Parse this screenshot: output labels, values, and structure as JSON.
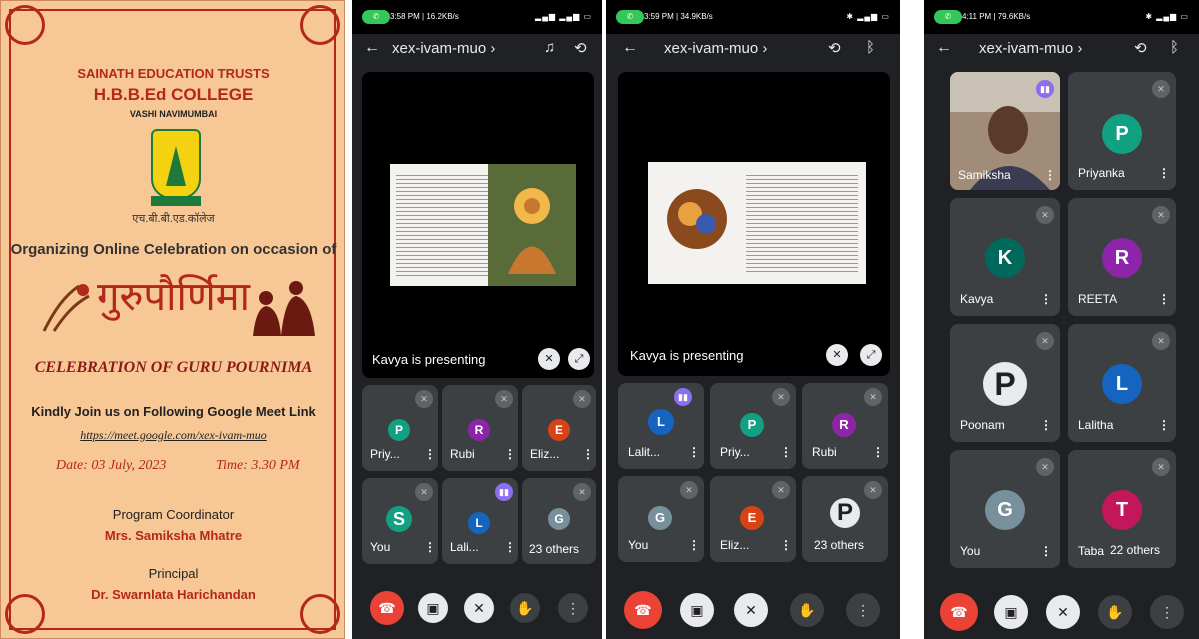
{
  "poster": {
    "trust": "SAINATH EDUCATION TRUSTS",
    "college": "H.B.B.Ed COLLEGE",
    "location": "VASHI NAVIMUMBAI",
    "hindi_name": "एच.बी.बी.एड.कॉलेज",
    "organizing": "Organizing Online Celebration on occasion of",
    "hindi_title": "गुरुपौर्णिमा",
    "celebration": "CELEBRATION OF GURU POURNIMA",
    "invite": "Kindly Join us on Following Google Meet Link",
    "link": "https://meet.google.com/xex-ivam-muo",
    "date": "Date: 03 July, 2023",
    "time": "Time: 3.30 PM",
    "coordinator_label": "Program Coordinator",
    "coordinator_name": "Mrs. Samiksha Mhatre",
    "principal_label": "Principal",
    "principal_name": "Dr. Swarnlata Harichandan",
    "accent": "#b3271d"
  },
  "phone1": {
    "status_time": "3:58 PM | 16.2KB/s",
    "meeting": "xex-ivam-muo",
    "presenting": "Kavya is presenting",
    "tiles": [
      {
        "initial": "P",
        "name": "Priy...",
        "color": "#12a082"
      },
      {
        "initial": "R",
        "name": "Rubi",
        "color": "#8e24aa"
      },
      {
        "initial": "E",
        "name": "Eliz...",
        "color": "#d84315"
      },
      {
        "initial": "S",
        "name": "You",
        "color": "#12a082"
      },
      {
        "initial": "L",
        "name": "Lali...",
        "color": "#1565c0"
      },
      {
        "initial": "G",
        "name": "",
        "color": "#78909c"
      }
    ],
    "others": "23 others"
  },
  "phone2": {
    "status_time": "3:59 PM | 34.9KB/s",
    "meeting": "xex-ivam-muo",
    "presenting": "Kavya is presenting",
    "tiles": [
      {
        "initial": "L",
        "name": "Lalit...",
        "color": "#1565c0"
      },
      {
        "initial": "P",
        "name": "Priy...",
        "color": "#12a082"
      },
      {
        "initial": "R",
        "name": "Rubi",
        "color": "#8e24aa"
      },
      {
        "initial": "G",
        "name": "You",
        "color": "#78909c"
      },
      {
        "initial": "E",
        "name": "Eliz...",
        "color": "#d84315"
      },
      {
        "initial": "P",
        "name": "",
        "color": "#e8eaed"
      }
    ],
    "others": "23 others"
  },
  "phone3": {
    "status_time": "4:11 PM | 79.6KB/s",
    "meeting": "xex-ivam-muo",
    "tiles": [
      {
        "initial": "",
        "name": "Samiksha",
        "color": "#7a6a5a"
      },
      {
        "initial": "P",
        "name": "Priyanka",
        "color": "#12a082"
      },
      {
        "initial": "K",
        "name": "Kavya",
        "color": "#00695c"
      },
      {
        "initial": "R",
        "name": "REETA",
        "color": "#8e24aa"
      },
      {
        "initial": "P",
        "name": "Poonam",
        "color": "#e8eaed"
      },
      {
        "initial": "L",
        "name": "Lalitha",
        "color": "#1565c0"
      },
      {
        "initial": "G",
        "name": "You",
        "color": "#78909c"
      },
      {
        "initial": "T",
        "name": "Taba",
        "color": "#c2185b"
      }
    ],
    "others": "22 others"
  }
}
